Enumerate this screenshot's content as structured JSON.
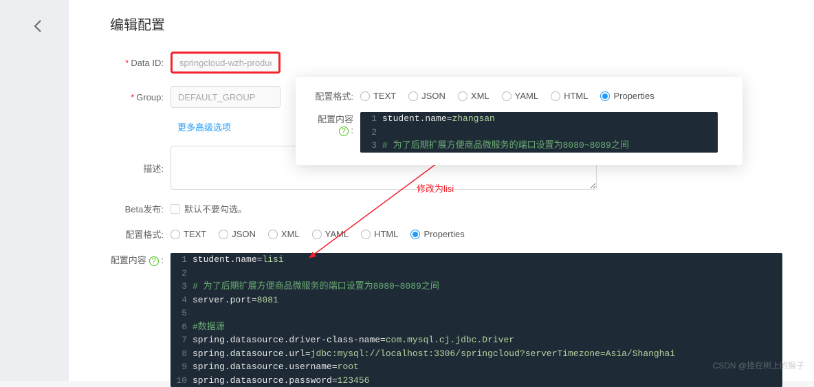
{
  "page_title": "编辑配置",
  "labels": {
    "data_id": "Data ID:",
    "group": "Group:",
    "advanced": "更多高级选项",
    "desc": "描述:",
    "beta": "Beta发布:",
    "beta_checkbox": "默认不要勾选。",
    "format": "配置格式:",
    "content": "配置内容"
  },
  "inputs": {
    "data_id": "springcloud-wzh-product",
    "group": "DEFAULT_GROUP"
  },
  "formats": [
    "TEXT",
    "JSON",
    "XML",
    "YAML",
    "HTML",
    "Properties"
  ],
  "format_selected": "Properties",
  "code_main": [
    {
      "n": 1,
      "t": "student.name=lisi"
    },
    {
      "n": 2,
      "t": ""
    },
    {
      "n": 3,
      "t": "# 为了后期扩展方便商品微服务的端口设置为8080~8089之间",
      "c": true
    },
    {
      "n": 4,
      "t": "server.port=8081"
    },
    {
      "n": 5,
      "t": ""
    },
    {
      "n": 6,
      "t": "#数据源",
      "c": true
    },
    {
      "n": 7,
      "t": "spring.datasource.driver-class-name=com.mysql.cj.jdbc.Driver"
    },
    {
      "n": 8,
      "t": "spring.datasource.url=jdbc:mysql://localhost:3306/springcloud?serverTimezone=Asia/Shanghai"
    },
    {
      "n": 9,
      "t": "spring.datasource.username=root"
    },
    {
      "n": 10,
      "t": "spring.datasource.password=123456"
    }
  ],
  "popup": {
    "format_label": "配置格式:",
    "content_label": "配置内容",
    "code": [
      {
        "n": 1,
        "t": "student.name=zhangsan"
      },
      {
        "n": 2,
        "t": ""
      },
      {
        "n": 3,
        "t": "# 为了后期扩展方便商品微服务的端口设置为8080~8089之间",
        "c": true
      }
    ]
  },
  "annotation": "修改为lisi",
  "watermark": "CSDN @挂在树上的猴子"
}
